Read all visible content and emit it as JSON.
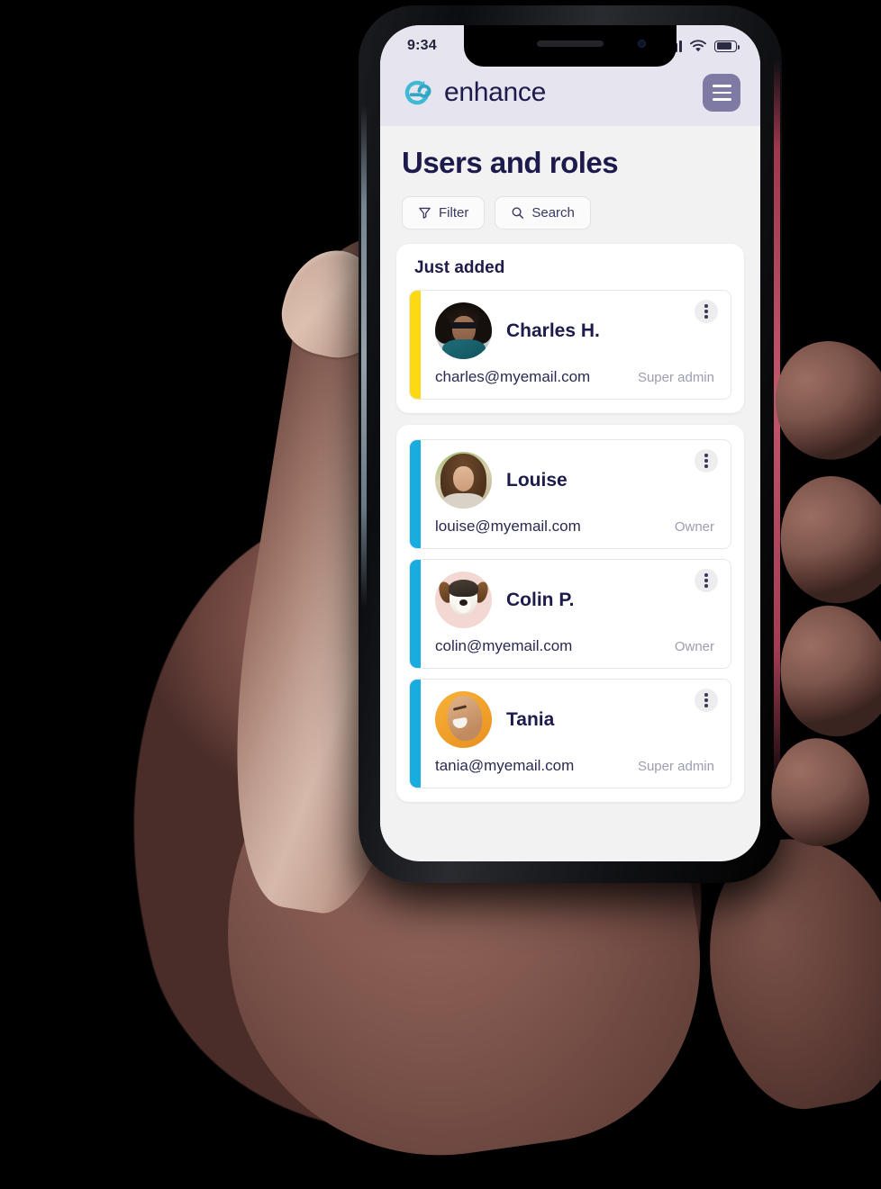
{
  "status_bar": {
    "time": "9:34",
    "signal_icon": "cellular-bars-icon",
    "wifi_icon": "wifi-icon",
    "battery_icon": "battery-icon"
  },
  "app_header": {
    "logo_icon": "enhance-circular-arrow-logo",
    "brand_name": "enhance",
    "menu_icon": "hamburger-menu-icon",
    "menu_color": "#7e7aa3"
  },
  "page": {
    "title": "Users and roles"
  },
  "toolbar": {
    "filter_label": "Filter",
    "filter_icon": "funnel-icon",
    "search_label": "Search",
    "search_icon": "magnifier-icon"
  },
  "just_added": {
    "title": "Just added",
    "users": [
      {
        "name": "Charles H.",
        "email": "charles@myemail.com",
        "role": "Super admin",
        "accent": "#fcd913",
        "avatar": "charles-portrait-avatar",
        "menu_icon": "kebab-menu-icon"
      }
    ]
  },
  "user_list": {
    "users": [
      {
        "name": "Louise",
        "email": "louise@myemail.com",
        "role": "Owner",
        "accent": "#18acdf",
        "avatar": "louise-portrait-avatar",
        "menu_icon": "kebab-menu-icon"
      },
      {
        "name": "Colin P.",
        "email": "colin@myemail.com",
        "role": "Owner",
        "accent": "#18acdf",
        "avatar": "colin-dog-avatar",
        "menu_icon": "kebab-menu-icon"
      },
      {
        "name": "Tania",
        "email": "tania@myemail.com",
        "role": "Super admin",
        "accent": "#18acdf",
        "avatar": "tania-portrait-avatar",
        "menu_icon": "kebab-menu-icon"
      }
    ]
  }
}
